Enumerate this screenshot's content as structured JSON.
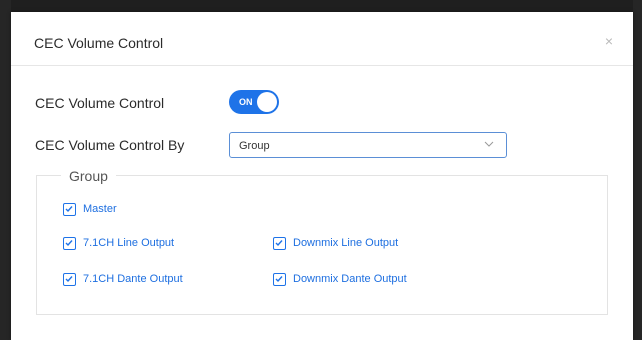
{
  "dialog": {
    "title": "CEC Volume Control",
    "close_glyph": "×"
  },
  "cec_volume_control": {
    "label": "CEC Volume Control",
    "toggle_text": "ON",
    "enabled": true
  },
  "cec_volume_control_by": {
    "label": "CEC Volume Control By",
    "selected": "Group"
  },
  "group": {
    "legend": "Group",
    "items": [
      {
        "label": "Master",
        "checked": true
      },
      {
        "label": "7.1CH Line Output",
        "checked": true
      },
      {
        "label": "Downmix Line Output",
        "checked": true
      },
      {
        "label": "7.1CH Dante Output",
        "checked": true
      },
      {
        "label": "Downmix Dante Output",
        "checked": true
      }
    ]
  },
  "colors": {
    "accent": "#1e73e8",
    "link_text": "#1e6fe0",
    "backdrop": "#8f8f8f"
  },
  "icons": {
    "close": "close-icon",
    "dropdown": "chevron-down-icon",
    "check": "checkmark-icon"
  }
}
